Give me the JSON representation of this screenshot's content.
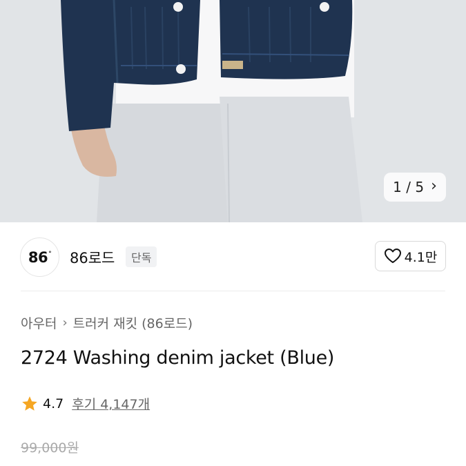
{
  "gallery": {
    "current_index": "1",
    "total": "5",
    "separator": "/"
  },
  "brand": {
    "logo_text": "86",
    "logo_mark": "°",
    "name": "86로드",
    "badge": "단독",
    "likes": "4.1만",
    "like_icon": "heart-outline-icon"
  },
  "breadcrumb": {
    "items": [
      "아우터",
      "트러커 재킷 (86로드)"
    ],
    "separator_icon": "chevron-right-icon"
  },
  "product": {
    "title": "2724 Washing denim jacket (Blue)",
    "rating": "4.7",
    "reviews": "후기 4,147개",
    "original_price": "99,000원"
  },
  "colors": {
    "star": "#f5a623",
    "denim": "#1f3350",
    "text_primary": "#111111",
    "text_secondary": "#666666"
  }
}
